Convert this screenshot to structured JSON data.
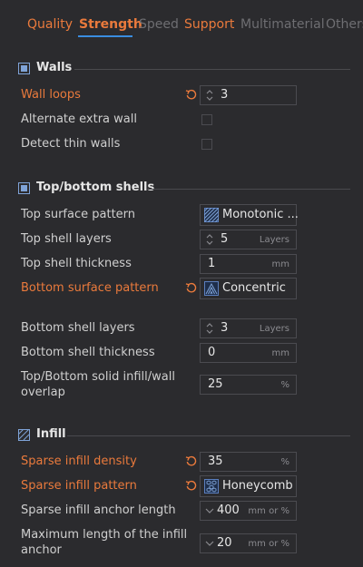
{
  "tabs": [
    {
      "label": "Quality"
    },
    {
      "label": "Strength"
    },
    {
      "label": "Speed"
    },
    {
      "label": "Support"
    },
    {
      "label": "Multimaterial"
    },
    {
      "label": "Others"
    }
  ],
  "walls": {
    "title": "Walls",
    "wall_loops": {
      "label": "Wall loops",
      "value": "3"
    },
    "alternate_extra_wall": {
      "label": "Alternate extra wall"
    },
    "detect_thin_walls": {
      "label": "Detect thin walls"
    }
  },
  "shells": {
    "title": "Top/bottom shells",
    "top_surface_pattern": {
      "label": "Top surface pattern",
      "value": "Monotonic ..."
    },
    "top_shell_layers": {
      "label": "Top shell layers",
      "value": "5",
      "unit": "Layers"
    },
    "top_shell_thickness": {
      "label": "Top shell thickness",
      "value": "1",
      "unit": "mm"
    },
    "bottom_surface_pattern": {
      "label": "Bottom surface pattern",
      "value": "Concentric"
    },
    "bottom_shell_layers": {
      "label": "Bottom shell layers",
      "value": "3",
      "unit": "Layers"
    },
    "bottom_shell_thickness": {
      "label": "Bottom shell thickness",
      "value": "0",
      "unit": "mm"
    },
    "overlap": {
      "label_line1": "Top/Bottom solid infill/wall",
      "label_line2": "overlap",
      "value": "25",
      "unit": "%"
    }
  },
  "infill": {
    "title": "Infill",
    "sparse_density": {
      "label": "Sparse infill density",
      "value": "35",
      "unit": "%"
    },
    "sparse_pattern": {
      "label": "Sparse infill pattern",
      "value": "Honeycomb"
    },
    "anchor_length": {
      "label": "Sparse infill anchor length",
      "value": "400",
      "unit": "mm or %"
    },
    "max_anchor": {
      "label_line1": "Maximum length of the infill",
      "label_line2": "anchor",
      "value": "20",
      "unit": "mm or %"
    }
  },
  "colors": {
    "accent": "#ea7a3c",
    "tab_underline": "#3a8de0",
    "background": "#2b2b2e"
  }
}
